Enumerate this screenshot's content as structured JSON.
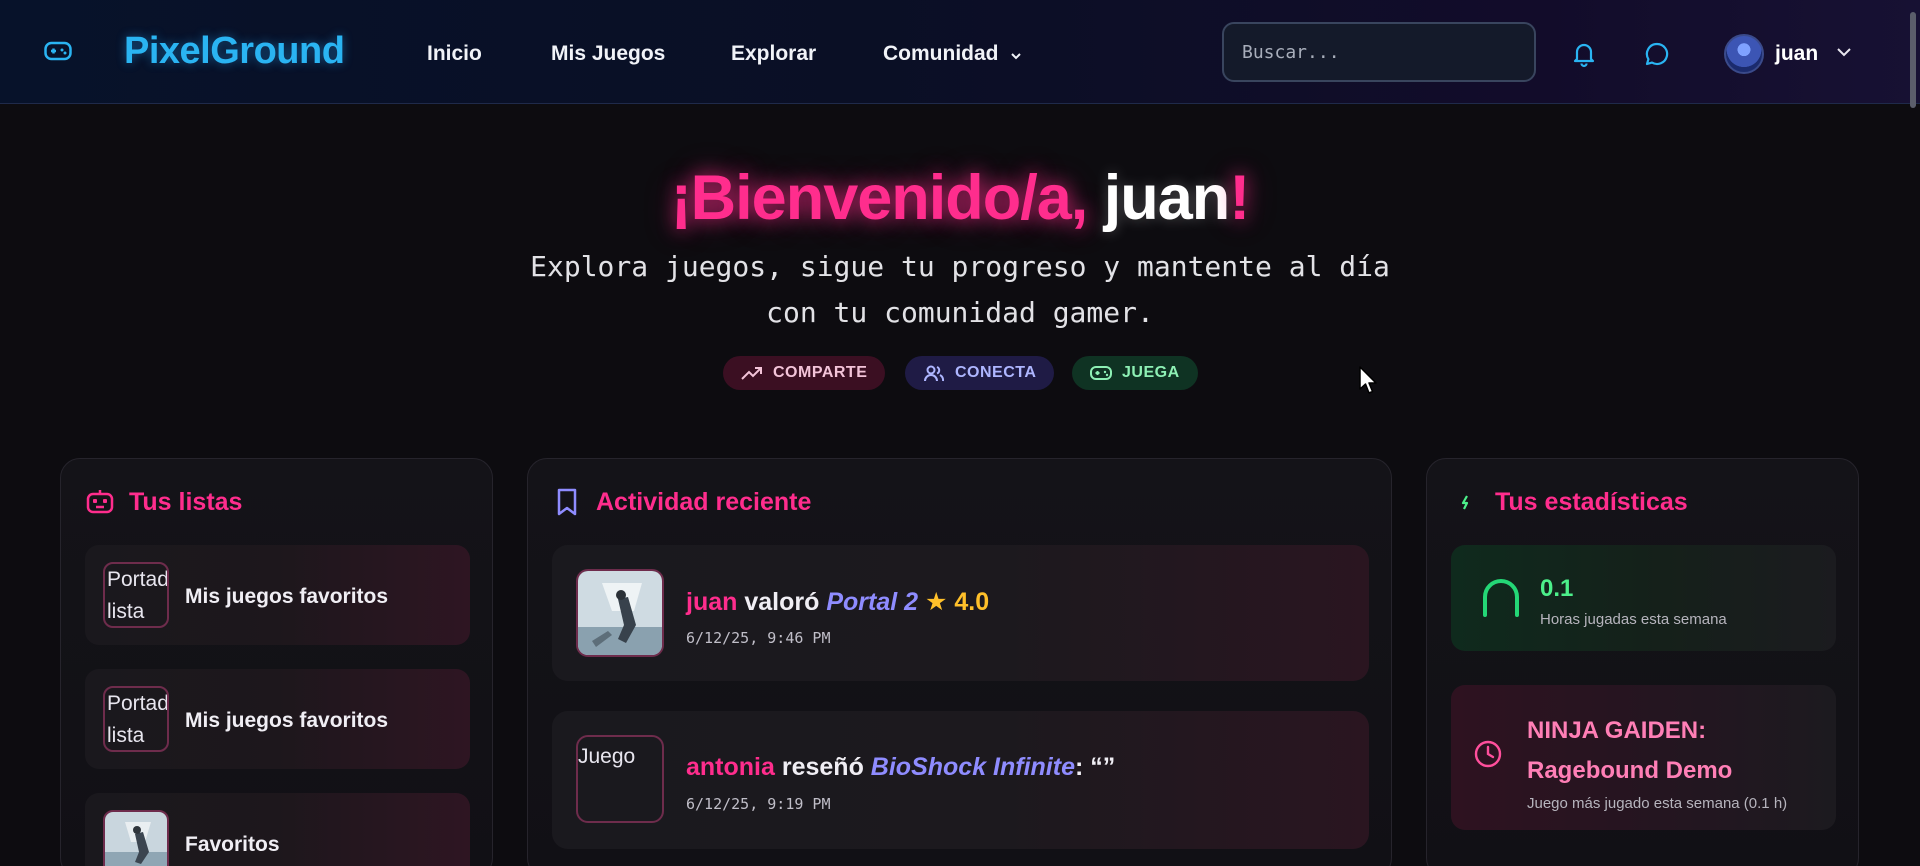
{
  "nav": {
    "brand": "PixelGround",
    "links": [
      "Inicio",
      "Mis Juegos",
      "Explorar",
      "Comunidad"
    ],
    "search_placeholder": "Buscar...",
    "user_name": "juan"
  },
  "hero": {
    "title_prefix": "¡Bienvenido/a, ",
    "title_user": "juan",
    "title_suffix": "!",
    "subtitle": "Explora juegos, sigue tu progreso y mantente al día con tu comunidad gamer.",
    "pills": [
      "COMPARTE",
      "CONECTA",
      "JUEGA"
    ]
  },
  "lists": {
    "title": "Tus listas",
    "items": [
      {
        "cover_alt": "Portada lista",
        "name": "Mis juegos favoritos"
      },
      {
        "cover_alt": "Portada lista",
        "name": "Mis juegos favoritos"
      },
      {
        "cover_alt": "",
        "name": "Favoritos"
      }
    ]
  },
  "activity": {
    "title": "Actividad reciente",
    "items": [
      {
        "user": "juan",
        "verb": "valoró",
        "game": "Portal 2",
        "star": "★",
        "rating": "4.0",
        "time": "6/12/25, 9:46 PM"
      },
      {
        "cover_alt": "Juego",
        "user": "antonia",
        "verb": "reseñó",
        "game": "BioShock Infinite",
        "review": ": “”",
        "time": "6/12/25, 9:19 PM"
      }
    ]
  },
  "stats": {
    "title": "Tus estadísticas",
    "hours_value": "0.1",
    "hours_label": "Horas jugadas esta semana",
    "top_game": "NINJA GAIDEN: Ragebound Demo",
    "top_game_label": "Juego más jugado esta semana (0.1 h)"
  },
  "colors": {
    "accent_pink": "#ff2d8d",
    "brand_blue": "#2ab4f2",
    "accent_green": "#4cf08a",
    "accent_purple": "#8f8cff",
    "star_gold": "#ffc02a"
  },
  "icons": [
    "gamepad-icon",
    "bell-icon",
    "chat-icon",
    "chevron-down-icon",
    "trending-up-icon",
    "users-icon",
    "robot-icon",
    "bookmark-icon",
    "bolt-icon",
    "gauge-icon",
    "clock-icon"
  ]
}
